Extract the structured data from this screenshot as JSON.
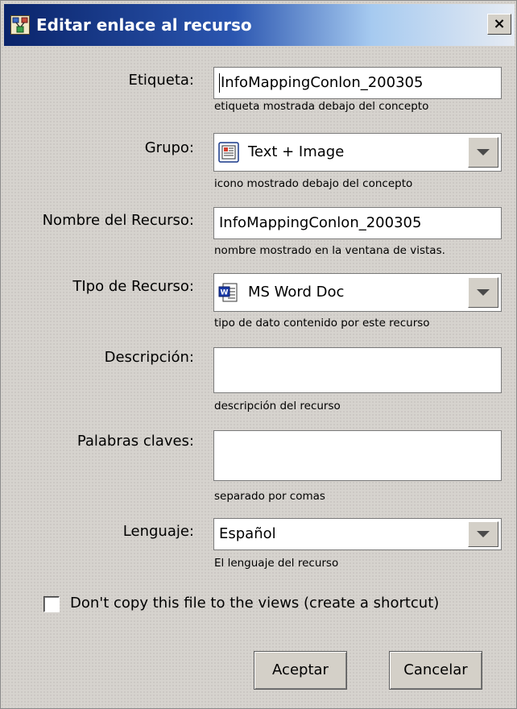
{
  "window": {
    "title": "Editar enlace al recurso",
    "close_glyph": "×"
  },
  "fields": {
    "etiqueta": {
      "label": "Etiqueta:",
      "value": "InfoMappingConlon_200305",
      "hint": "etiqueta mostrada debajo del concepto"
    },
    "grupo": {
      "label": "Grupo:",
      "selected": "Text + Image",
      "icon": "text-image-icon",
      "hint": "icono mostrado debajo del concepto"
    },
    "nombre": {
      "label": "Nombre del Recurso:",
      "value": "InfoMappingConlon_200305",
      "hint": "nombre mostrado en la ventana de vistas."
    },
    "tipo": {
      "label": "TIpo de Recurso:",
      "selected": "MS Word Doc",
      "icon": "ms-word-doc-icon",
      "hint": "tipo de dato contenido por este recurso"
    },
    "descripcion": {
      "label": "Descripción:",
      "value": "",
      "hint": "descripción del recurso"
    },
    "palabras": {
      "label": "Palabras claves:",
      "value": "",
      "hint": "separado por comas"
    },
    "lenguaje": {
      "label": "Lenguaje:",
      "selected": "Español",
      "hint": "El lenguaje del recurso"
    }
  },
  "shortcut_checkbox": {
    "label": "Don't copy this file to the views (create a shortcut)",
    "checked": false
  },
  "buttons": {
    "ok": "Aceptar",
    "cancel": "Cancelar"
  },
  "colors": {
    "title_gradient_start": "#0a246a",
    "title_gradient_end": "#a6caf0",
    "dialog_background": "#d6d3ce"
  }
}
